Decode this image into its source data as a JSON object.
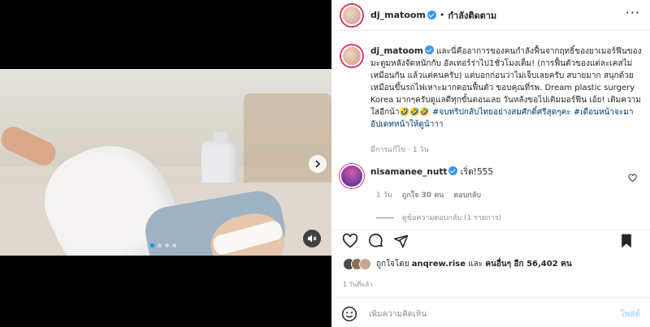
{
  "post": {
    "username": "dj_matoom",
    "separator": "•",
    "follow_status": "กำลังติดตาม",
    "more_glyph": "···",
    "caption_username": "dj_matoom",
    "caption_text": "และนี่คืออาการของคนกำลังฟื้นจากฤทธิ์ของยาเมอร์ฟีนของมะตูมหลังจัดหนักกับ อัลเทอร์ร่าไป1ชั่วโมงเต็ม! (การฟื้นตัวของแต่ละเคสไม่เหมือนกัน แล้วแต่คนครับ) แต่บอกก่อนว่าไม่เจ็บเลยครับ สบายมาก สนุกด้วยเหมือนขึ้นรถไฟเหาะมากตอนฟื้นตัว ขอบคุณที่รพ. Dream plastic surgery Korea มากๆครับดูแลดีทุกขั้นตอนเลย วันหลังขอไปเติมมอร์ฟีน เอ้ย! เติมความใสอีกน้า🤣🤣🤣 ",
    "caption_hashtags": "#จบทริปกลับไทยอย่างสมศักดิ์ศรีสุดๆคะ #เดือนหน้าจะมาอัปเดทหน้าให้ดูน้าาา",
    "edited_label": "มีการแก้ไข · 1 วัน"
  },
  "comment": {
    "username": "nisamanee_nutt",
    "text": "เริ่ด!555",
    "age": "1 วัน",
    "likes": "ถูกใจ 30 คน",
    "reply_label": "ตอบกลับ",
    "view_replies": "ดูข้อความตอบกลับ (1 รายการ)"
  },
  "likes": {
    "prefix": "ถูกใจโดย",
    "user": "anqrew.rise",
    "connector": "และ",
    "others": "คนอื่นๆ อีก 56,402 คน"
  },
  "timestamp": "1 วันที่แล้ว",
  "composer": {
    "placeholder": "เพิ่มความคิดเห็น",
    "post_label": "โพสต์"
  },
  "media": {
    "dot_count": 4,
    "active_dot": 0
  },
  "icons": {
    "heart": "heart-icon",
    "comment": "comment-icon",
    "share": "share-icon",
    "save": "bookmark-icon",
    "emoji": "emoji-icon",
    "mute": "muted-icon",
    "next": "chevron-right-icon"
  },
  "colors": {
    "link": "#00376b",
    "verified": "#3897f0",
    "post_disabled": "#b2dffc",
    "muted_text": "#8e8e8e"
  }
}
